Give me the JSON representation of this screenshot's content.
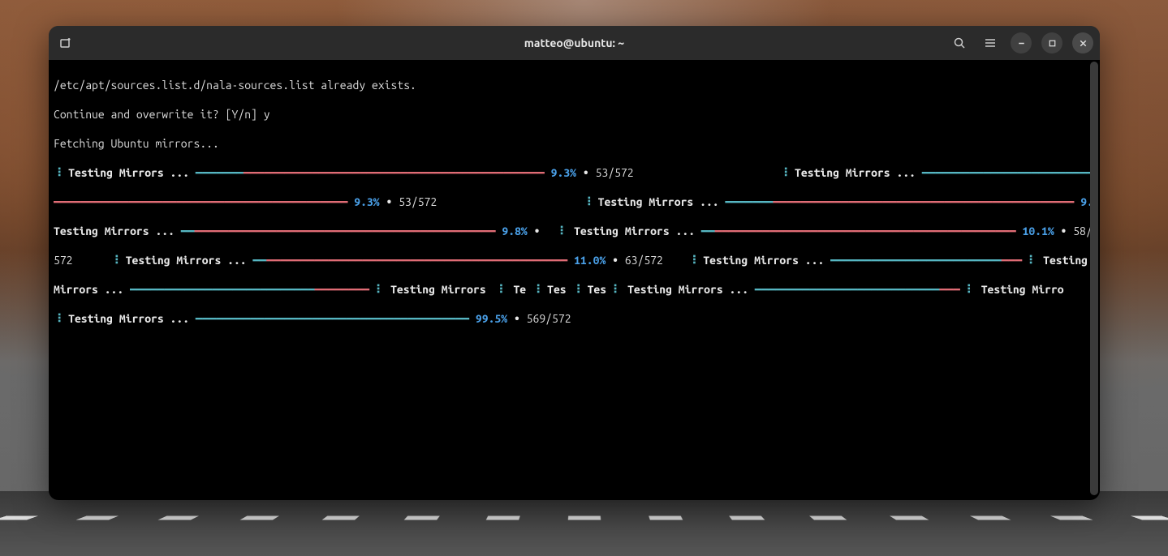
{
  "window": {
    "title": "matteo@ubuntu: ~"
  },
  "terminal": {
    "line1": "/etc/apt/sources.list.d/nala-sources.list already exists.",
    "line2": "Continue and overwrite it? [Y/n] y",
    "line3": "Fetching Ubuntu mirrors...",
    "label_testing": "Testing Mirrors ...",
    "label_testing_short1": "Te",
    "label_testing_short2": "Tes",
    "label_testing_short3": "Tes",
    "label_testing_mirro": "Testing Mirro",
    "label_testing_plain": "Testing",
    "label_mirrors": "Mirrors ...",
    "pct_93": "9.3%",
    "pct_98": "9.8%",
    "pct_101": "10.1%",
    "pct_110": "11.0%",
    "pct_995": "99.5%",
    "frac_53": "53/572",
    "frac_58": "58/",
    "frac_572": "572",
    "frac_63": "63/572",
    "frac_569": "569/572",
    "bullet": "•",
    "dots_prefix": "⠸",
    "dots_prefix2": "⠇",
    "cyan_bar_short": "━━━━━━━",
    "red_bar_long": "━━━━━━━━━━━━━━━━━━━━━━━━━━━━━━━━━━━━━━━━━━━━",
    "cyan_bar_med": "━━━━━━━━━━━━━━━━━━━━━━━━━━━━━━━━━━━━━━━━━━━━━━━━━━━━━━━━━━━━━━━━━━━━━━━━━━━━━━━",
    "red_bar_short": "━━━━━━━━━━━━━━━━━━━━━━━━━━━━━━━━━━━━━━━━━━━━━━━━━━━━━━━━━━",
    "cyan_seg1": "━━━━━━━━━━━━━━━━━━━━━━━━━━━",
    "red_seg1": "━━━━━━━━━━━━━━━━━━━━━━━━━━━━━━━━━━━━",
    "cyan_seg2": "━━━━━━━━━━━━━━━━━━━━━━━━━",
    "red_seg2": "━━━━━━━━━━━━━━━━━━━━━━━━━━━━━━━━━━━━━━━━━━━━━━━━━━━━━━━━━━━━━━━━━━━━━━",
    "red_seg3": "━━━━━━━━",
    "cyan_seg3": "━━━━━━━━━━━━━━━━━━━━━━━━━━━━━━━━━━━━━━━━",
    "red_seg4": "━━━━━━━━━━━━━━━━━━━━━━━━━━━━━━━━━━━━━━━━━━━━━━━━━━━━",
    "cyan_seg4": "━━━━━━━━━━━━━━━━━━━━━━━━━━━━━━━━━━━",
    "red_seg5": "━━━━━━━━━━━━━━━━━━━━━━━━━━━━━━━━━━━━━━━━━━━",
    "cyan_tiny": "━━",
    "red_tiny": "━━━"
  }
}
